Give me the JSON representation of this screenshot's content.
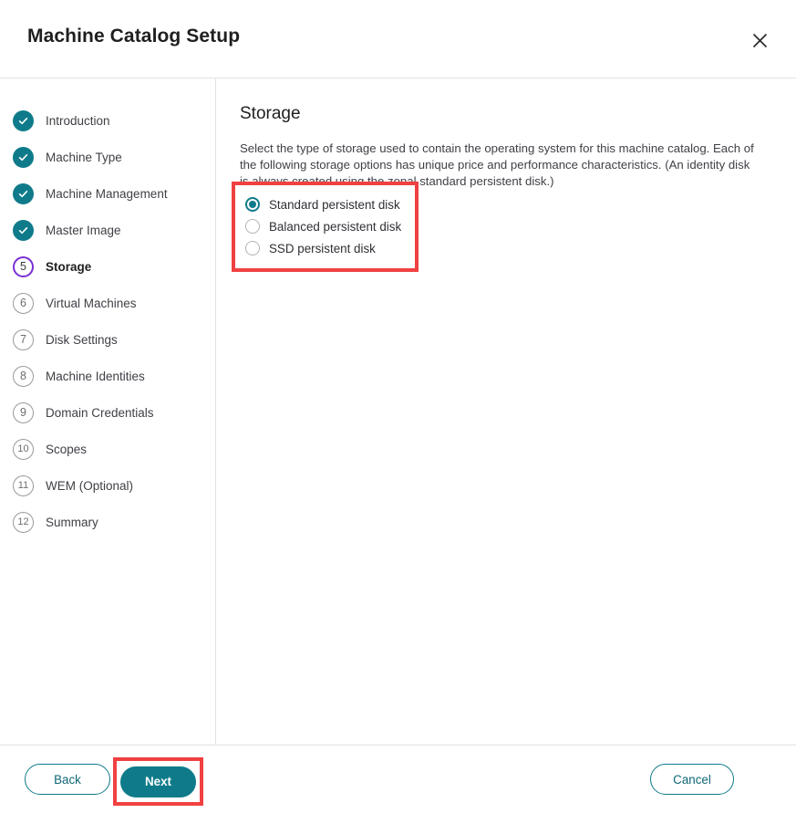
{
  "header": {
    "title": "Machine Catalog Setup",
    "close_icon": "close-icon"
  },
  "sidebar": {
    "steps": [
      {
        "number": "1",
        "label": "Introduction",
        "state": "done"
      },
      {
        "number": "2",
        "label": "Machine Type",
        "state": "done"
      },
      {
        "number": "3",
        "label": "Machine Management",
        "state": "done"
      },
      {
        "number": "4",
        "label": "Master Image",
        "state": "done"
      },
      {
        "number": "5",
        "label": "Storage",
        "state": "current"
      },
      {
        "number": "6",
        "label": "Virtual Machines",
        "state": "pending"
      },
      {
        "number": "7",
        "label": "Disk Settings",
        "state": "pending"
      },
      {
        "number": "8",
        "label": "Machine Identities",
        "state": "pending"
      },
      {
        "number": "9",
        "label": "Domain Credentials",
        "state": "pending"
      },
      {
        "number": "10",
        "label": "Scopes",
        "state": "pending"
      },
      {
        "number": "11",
        "label": "WEM (Optional)",
        "state": "pending"
      },
      {
        "number": "12",
        "label": "Summary",
        "state": "pending"
      }
    ]
  },
  "main": {
    "title": "Storage",
    "description": "Select the type of storage used to contain the operating system for this machine catalog. Each of the following storage options has unique price and performance characteristics. (An identity disk is always created using the zonal standard persistent disk.)",
    "storage_options": [
      {
        "label": "Standard persistent disk",
        "selected": true
      },
      {
        "label": "Balanced persistent disk",
        "selected": false
      },
      {
        "label": "SSD persistent disk",
        "selected": false
      }
    ]
  },
  "footer": {
    "back_label": "Back",
    "next_label": "Next",
    "cancel_label": "Cancel"
  },
  "colors": {
    "accent_teal": "#0f7b8a",
    "current_step_purple": "#7a2fd4",
    "highlight_red": "#f04141"
  }
}
